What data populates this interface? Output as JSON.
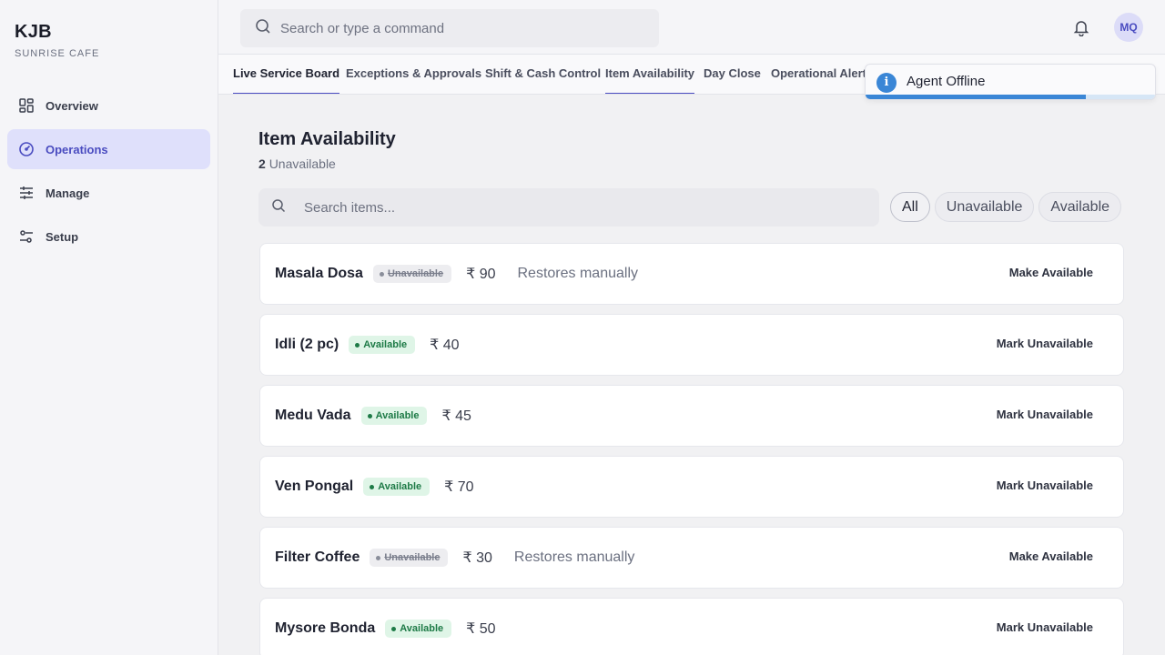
{
  "brand": {
    "name": "KJB",
    "subtitle": "SUNRISE CAFE"
  },
  "sidebar": {
    "items": [
      {
        "label": "Overview",
        "icon": "grid-icon",
        "active": false
      },
      {
        "label": "Operations",
        "icon": "gauge-icon",
        "active": true
      },
      {
        "label": "Manage",
        "icon": "sliders-icon",
        "active": false
      },
      {
        "label": "Setup",
        "icon": "settings-sliders-icon",
        "active": false
      }
    ]
  },
  "header": {
    "search_placeholder": "Search or type a command",
    "user_initials": "MQ"
  },
  "tabs": [
    {
      "label": "Live Service Board"
    },
    {
      "label": "Exceptions & Approvals"
    },
    {
      "label": "Shift & Cash Control"
    },
    {
      "label": "Item Availability"
    },
    {
      "label": "Day Close"
    },
    {
      "label": "Operational Alerts"
    }
  ],
  "toast": {
    "message": "Agent Offline",
    "progress_percent": 76
  },
  "main": {
    "title": "Item Availability",
    "unavailable_count": "2",
    "unavailable_label": "Unavailable",
    "search_placeholder": "Search items...",
    "filters": [
      {
        "label": "All",
        "active": true
      },
      {
        "label": "Unavailable",
        "active": false
      },
      {
        "label": "Available",
        "active": false
      }
    ],
    "items": [
      {
        "name": "Masala Dosa",
        "status": "Unavailable",
        "price": "₹ 90",
        "note": "Restores manually",
        "action": "Make Available"
      },
      {
        "name": "Idli (2 pc)",
        "status": "Available",
        "price": "₹ 40",
        "note": "",
        "action": "Mark Unavailable"
      },
      {
        "name": "Medu Vada",
        "status": "Available",
        "price": "₹ 45",
        "note": "",
        "action": "Mark Unavailable"
      },
      {
        "name": "Ven Pongal",
        "status": "Available",
        "price": "₹ 70",
        "note": "",
        "action": "Mark Unavailable"
      },
      {
        "name": "Filter Coffee",
        "status": "Unavailable",
        "price": "₹ 30",
        "note": "Restores manually",
        "action": "Make Available"
      },
      {
        "name": "Mysore Bonda",
        "status": "Available",
        "price": "₹ 50",
        "note": "",
        "action": "Mark Unavailable"
      }
    ]
  },
  "colors": {
    "accent": "#4a4cc0",
    "available_bg": "#dff5e7",
    "available_fg": "#1d7a46",
    "unavailable_bg": "#ededf0",
    "info_blue": "#3a86d6"
  }
}
